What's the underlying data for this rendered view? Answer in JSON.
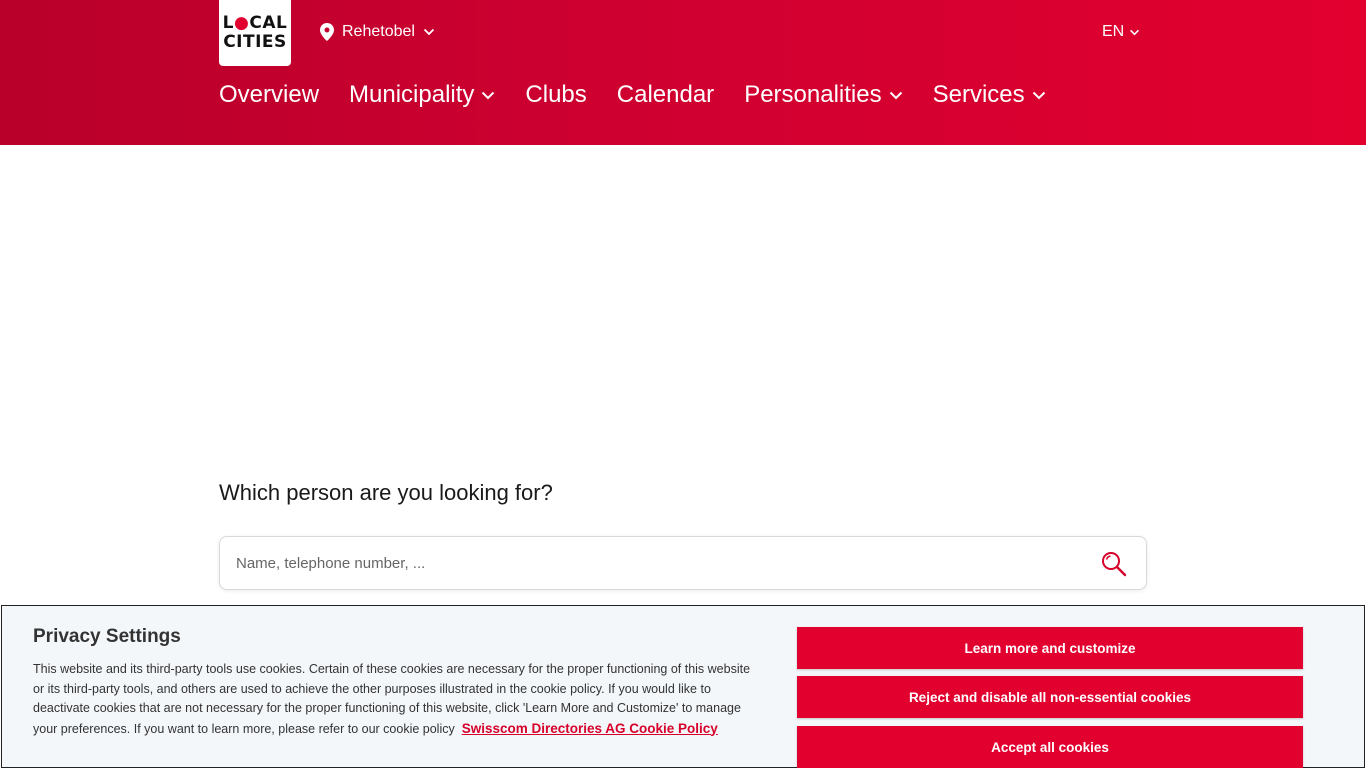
{
  "header": {
    "logo_line1": "LOCAL",
    "logo_line2": "CITIES",
    "location": "Rehetobel",
    "language": "EN"
  },
  "nav": {
    "items": [
      {
        "label": "Overview"
      },
      {
        "label": "Municipality"
      },
      {
        "label": "Clubs"
      },
      {
        "label": "Calendar"
      },
      {
        "label": "Personalities"
      },
      {
        "label": "Services"
      }
    ]
  },
  "search": {
    "question": "Which person are you looking for?",
    "placeholder": "Name, telephone number, ..."
  },
  "cookie": {
    "title": "Privacy Settings",
    "text": "This website and its third-party tools use cookies. Certain of these cookies are necessary for the proper functioning of this website or its third-party tools, and others are used to achieve the other purposes illustrated in the cookie policy. If you would like to deactivate cookies that are not necessary for the proper functioning of this website, click 'Learn More and Customize' to manage your preferences. If you want to learn more, please refer to our cookie policy",
    "link": "Swisscom Directories AG Cookie Policy",
    "btn_customize": "Learn more and customize",
    "btn_reject": "Reject and disable all non-essential cookies",
    "btn_accept": "Accept all cookies"
  },
  "colors": {
    "brand_red": "#e2002f",
    "brand_red_dark": "#b8002a"
  }
}
